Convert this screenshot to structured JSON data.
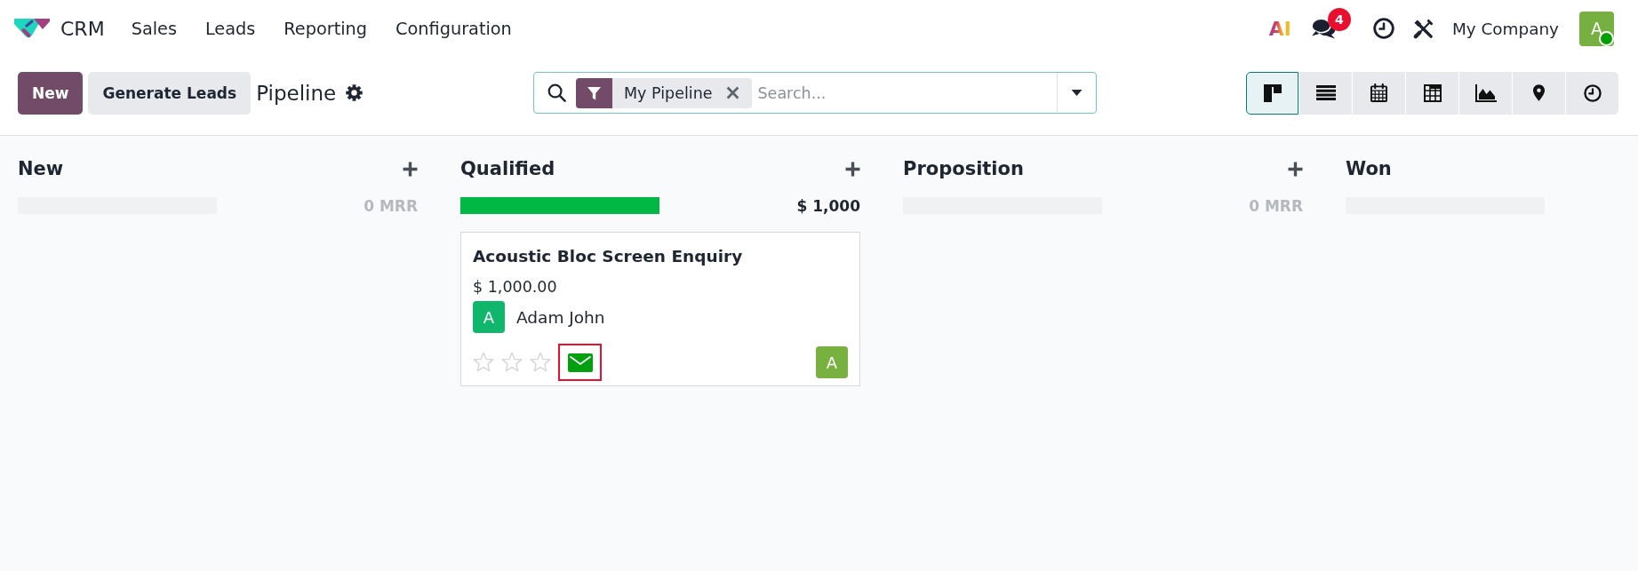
{
  "app": {
    "name": "CRM"
  },
  "menu": [
    "Sales",
    "Leads",
    "Reporting",
    "Configuration"
  ],
  "systray": {
    "ai_label": "AI",
    "notification_count": "4",
    "company": "My Company",
    "avatar": {
      "initial": "A",
      "online": true
    }
  },
  "control_panel": {
    "buttons": [
      {
        "label": "New",
        "kind": "primary"
      },
      {
        "label": "Generate Leads",
        "kind": "secondary"
      }
    ],
    "title": "Pipeline"
  },
  "search": {
    "facets": [
      {
        "label": "My Pipeline"
      }
    ],
    "placeholder": "Search..."
  },
  "view_switcher": [
    {
      "kind": "kanban",
      "selected": true
    },
    {
      "kind": "list",
      "selected": false
    },
    {
      "kind": "calendar",
      "selected": false
    },
    {
      "kind": "pivot",
      "selected": false
    },
    {
      "kind": "graph",
      "selected": false
    },
    {
      "kind": "map",
      "selected": false
    },
    {
      "kind": "activity",
      "selected": false
    }
  ],
  "columns": [
    {
      "title": "New",
      "level": 0,
      "total": "0 MRR"
    },
    {
      "title": "Qualified",
      "level": 1,
      "total": "$ 1,000",
      "cards": [
        {
          "title": "Acoustic Bloc Screen Enquiry",
          "amount": "$ 1,000.00",
          "contact": {
            "initial": "A",
            "name": "Adam John"
          },
          "stars": 0,
          "activity": {
            "kind": "email",
            "highlighted": true
          },
          "salesperson": {
            "initial": "A"
          }
        }
      ]
    },
    {
      "title": "Proposition",
      "level": 0,
      "total": "0 MRR"
    },
    {
      "title": "Won",
      "level": 0
    }
  ]
}
